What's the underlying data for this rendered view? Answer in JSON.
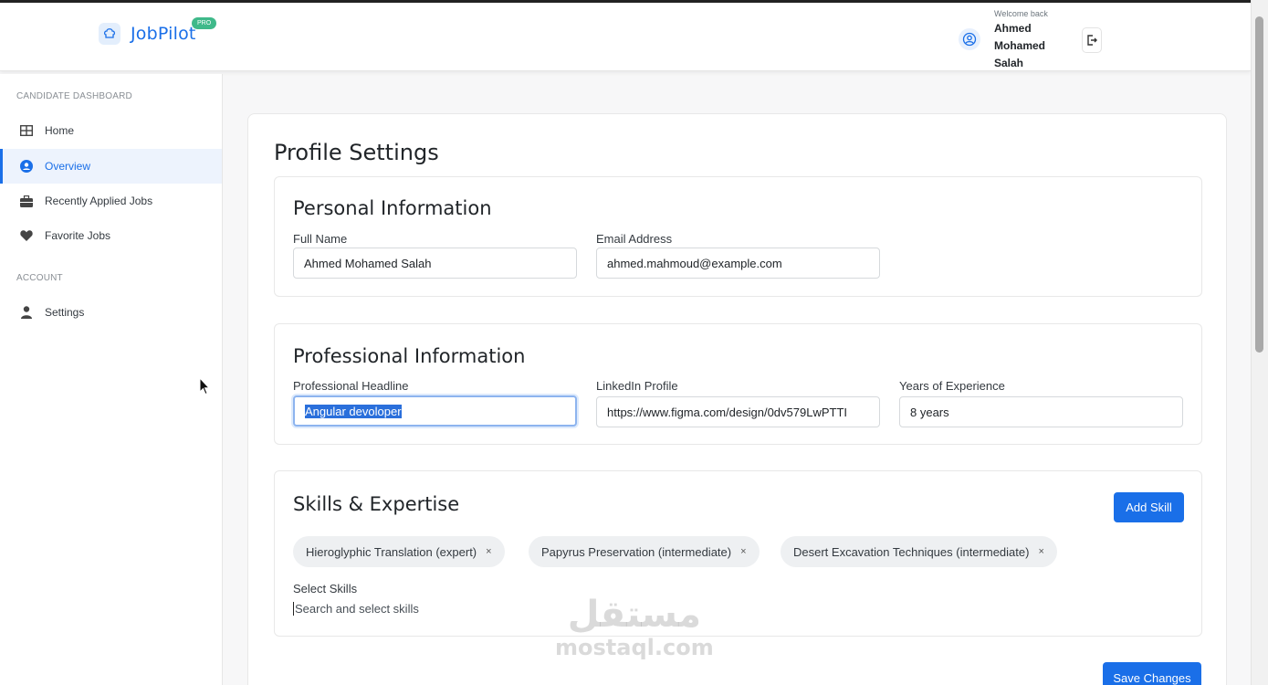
{
  "header": {
    "app_name": "JobPilot",
    "badge": "PRO",
    "welcome": "Welcome back",
    "user_name": "Ahmed Mohamed Salah"
  },
  "sidebar": {
    "dashboard_label": "CANDIDATE DASHBOARD",
    "account_label": "ACCOUNT",
    "items": [
      {
        "label": "Home",
        "icon": "grid-icon"
      },
      {
        "label": "Overview",
        "icon": "user-circle-icon",
        "active": true
      },
      {
        "label": "Recently Applied Jobs",
        "icon": "briefcase-icon"
      },
      {
        "label": "Favorite Jobs",
        "icon": "heart-icon"
      }
    ],
    "account_items": [
      {
        "label": "Settings",
        "icon": "person-icon"
      }
    ]
  },
  "main": {
    "title": "Profile Settings",
    "personal": {
      "title": "Personal Information",
      "full_name_label": "Full Name",
      "full_name_value": "Ahmed Mohamed Salah",
      "email_label": "Email Address",
      "email_value": "ahmed.mahmoud@example.com"
    },
    "professional": {
      "title": "Professional Information",
      "headline_label": "Professional Headline",
      "headline_value": "Angular devoloper",
      "linkedin_label": "LinkedIn Profile",
      "linkedin_value": "https://www.figma.com/design/0dv579LwPTTI",
      "experience_label": "Years of Experience",
      "experience_value": "8 years"
    },
    "skills": {
      "title": "Skills & Expertise",
      "add_button": "Add Skill",
      "chips": [
        "Hieroglyphic Translation (expert)",
        "Papyrus Preservation (intermediate)",
        "Desert Excavation Techniques (intermediate)"
      ],
      "remove_glyph": "×",
      "select_label": "Select Skills",
      "search_placeholder": "Search and select skills"
    },
    "save_button": "Save Changes"
  },
  "watermark": {
    "arabic": "مستقل",
    "latin": "mostaql.com"
  },
  "colors": {
    "accent": "#1a6fe8",
    "badge": "#3fb98a",
    "active_bg": "#edf3fd"
  }
}
